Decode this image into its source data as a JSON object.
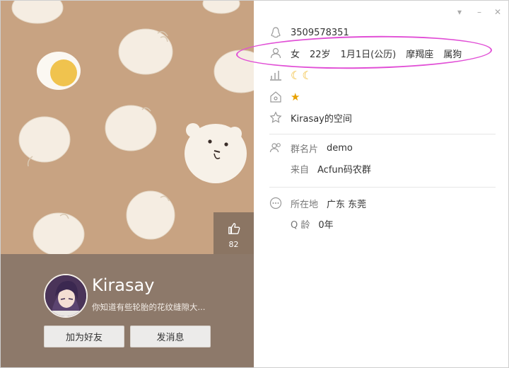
{
  "profile": {
    "name": "Kirasay",
    "signature": "你知道有些轮胎的花纹缝隙大...",
    "like_count": "82",
    "add_friend_label": "加为好友",
    "send_message_label": "发消息"
  },
  "info": {
    "qq_number": "3509578351",
    "gender": "女",
    "age": "22岁",
    "birthday": "1月1日(公历)",
    "zodiac": "摩羯座",
    "chinese_zodiac": "属狗",
    "space_link": "Kirasay的空间"
  },
  "group": {
    "card_label": "群名片",
    "card_value": "demo",
    "from_label": "来自",
    "from_value": "Acfun码农群"
  },
  "location": {
    "label": "所在地",
    "value": "广东 东莞",
    "qage_label": "Q 龄",
    "qage_value": "0年"
  },
  "colors": {
    "annotation_oval": "#e14fd6",
    "background_pattern": "#c8a382",
    "card_bg": "#8d796a"
  }
}
